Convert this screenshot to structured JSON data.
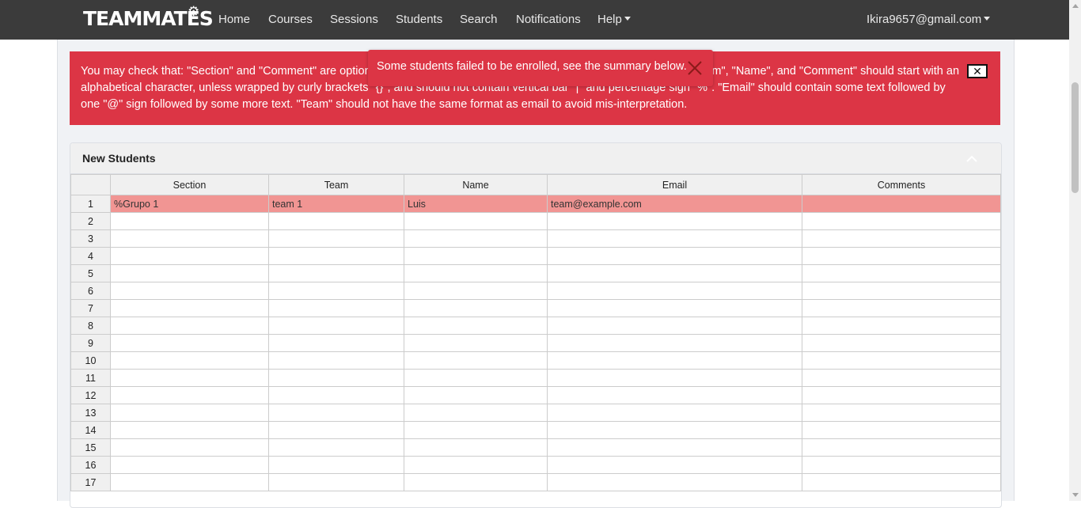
{
  "navbar": {
    "brand": "TEAMMATES",
    "items": [
      {
        "label": "Home"
      },
      {
        "label": "Courses"
      },
      {
        "label": "Sessions"
      },
      {
        "label": "Students"
      },
      {
        "label": "Search"
      },
      {
        "label": "Notifications"
      },
      {
        "label": "Help"
      }
    ],
    "user_email": "Ikira9657@gmail.com"
  },
  "alert": {
    "text": "You may check that: \"Section\" and \"Comment\" are optional while \"Team\", \"Name\", and \"Email\" must be filled. \"Section\", \"Team\", \"Name\", and \"Comment\" should start with an alphabetical character, unless wrapped by curly brackets \"{}\", and should not contain vertical bar \"|\" and percentage sign \"%\". \"Email\" should contain some text followed by one \"@\" sign followed by some more text. \"Team\" should not have the same format as email to avoid mis-interpretation.",
    "close_label": "✕"
  },
  "toast": {
    "text": "Some students failed to be enrolled, see the summary below."
  },
  "card": {
    "title": "New Students"
  },
  "table": {
    "headers": [
      "",
      "Section",
      "Team",
      "Name",
      "Email",
      "Comments"
    ],
    "rows": [
      [
        "1",
        "%Grupo 1",
        "team 1",
        "Luis",
        "team@example.com",
        ""
      ],
      [
        "2",
        "",
        "",
        "",
        "",
        ""
      ],
      [
        "3",
        "",
        "",
        "",
        "",
        ""
      ],
      [
        "4",
        "",
        "",
        "",
        "",
        ""
      ],
      [
        "5",
        "",
        "",
        "",
        "",
        ""
      ],
      [
        "6",
        "",
        "",
        "",
        "",
        ""
      ],
      [
        "7",
        "",
        "",
        "",
        "",
        ""
      ],
      [
        "8",
        "",
        "",
        "",
        "",
        ""
      ],
      [
        "9",
        "",
        "",
        "",
        "",
        ""
      ],
      [
        "10",
        "",
        "",
        "",
        "",
        ""
      ],
      [
        "11",
        "",
        "",
        "",
        "",
        ""
      ],
      [
        "12",
        "",
        "",
        "",
        "",
        ""
      ],
      [
        "13",
        "",
        "",
        "",
        "",
        ""
      ],
      [
        "14",
        "",
        "",
        "",
        "",
        ""
      ],
      [
        "15",
        "",
        "",
        "",
        "",
        ""
      ],
      [
        "16",
        "",
        "",
        "",
        "",
        ""
      ],
      [
        "17",
        "",
        "",
        "",
        "",
        ""
      ]
    ],
    "error_rows": [
      0
    ]
  },
  "colors": {
    "navbar": "#3b3b3b",
    "alert": "#dc3545",
    "error_row": "#f19593"
  }
}
